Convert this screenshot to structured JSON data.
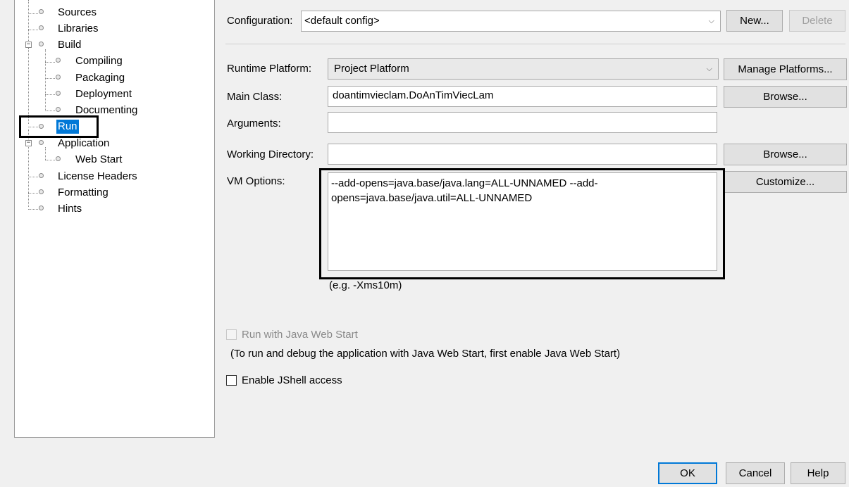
{
  "tree": {
    "items": [
      {
        "label": "Sources"
      },
      {
        "label": "Libraries"
      },
      {
        "label": "Build"
      },
      {
        "label": "Compiling"
      },
      {
        "label": "Packaging"
      },
      {
        "label": "Deployment"
      },
      {
        "label": "Documenting"
      },
      {
        "label": "Run"
      },
      {
        "label": "Application"
      },
      {
        "label": "Web Start"
      },
      {
        "label": "License Headers"
      },
      {
        "label": "Formatting"
      },
      {
        "label": "Hints"
      }
    ],
    "selected": "Run"
  },
  "configuration": {
    "label": "Configuration:",
    "value": "<default config>",
    "new_label": "New...",
    "delete_label": "Delete"
  },
  "form": {
    "runtime_platform_label": "Runtime Platform:",
    "runtime_platform_value": "Project Platform",
    "manage_platforms_label": "Manage Platforms...",
    "main_class_label": "Main Class:",
    "main_class_value": "doantimvieclam.DoAnTimViecLam",
    "browse_main_label": "Browse...",
    "arguments_label": "Arguments:",
    "arguments_value": "",
    "working_dir_label": "Working Directory:",
    "working_dir_value": "",
    "browse_working_label": "Browse...",
    "vm_options_label": "VM Options:",
    "vm_options_value": "--add-opens=java.base/java.lang=ALL-UNNAMED --add-opens=java.base/java.util=ALL-UNNAMED",
    "customize_label": "Customize...",
    "vm_hint": "(e.g. -Xms10m)",
    "run_web_start_label": "Run with Java Web Start",
    "web_start_note": "(To run and debug the application with Java Web Start, first enable Java Web Start)",
    "jshell_label": "Enable JShell access"
  },
  "footer": {
    "ok_label": "OK",
    "cancel_label": "Cancel",
    "help_label": "Help"
  },
  "colors": {
    "selection": "#0078d7",
    "default_button_border": "#0078d7"
  }
}
